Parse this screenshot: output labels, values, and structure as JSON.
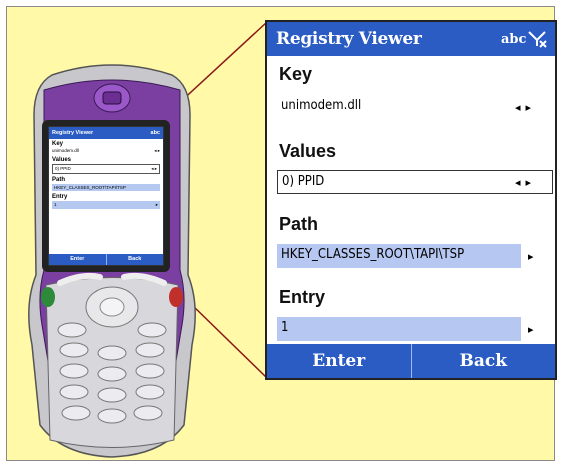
{
  "window": {
    "title": "Registry Viewer",
    "input_mode": "abc"
  },
  "icons": {
    "signal": "no-signal-icon"
  },
  "sections": {
    "key": {
      "label": "Key",
      "value": "unimodem.dll"
    },
    "values": {
      "label": "Values",
      "value": "0) PPID"
    },
    "path": {
      "label": "Path",
      "value": "HKEY_CLASSES_ROOT\\TAPI\\TSP"
    },
    "entry": {
      "label": "Entry",
      "value": "1"
    }
  },
  "softkeys": {
    "left": "Enter",
    "right": "Back"
  },
  "mini": {
    "title": "Registry Viewer",
    "abc": "abc",
    "key_label": "Key",
    "key_value": "unimodem.dll",
    "values_label": "Values",
    "values_value": "0) PPID",
    "path_label": "Path",
    "path_value": "HKEY_CLASSES_ROOT\\TAPI\\TSP",
    "entry_label": "Entry",
    "entry_value": "1",
    "left_soft": "Enter",
    "right_soft": "Back"
  },
  "colors": {
    "accent": "#2b5cc4",
    "highlight": "#b6c8f2",
    "background": "#fff9a8",
    "phone_body": "#7a3fa0"
  }
}
